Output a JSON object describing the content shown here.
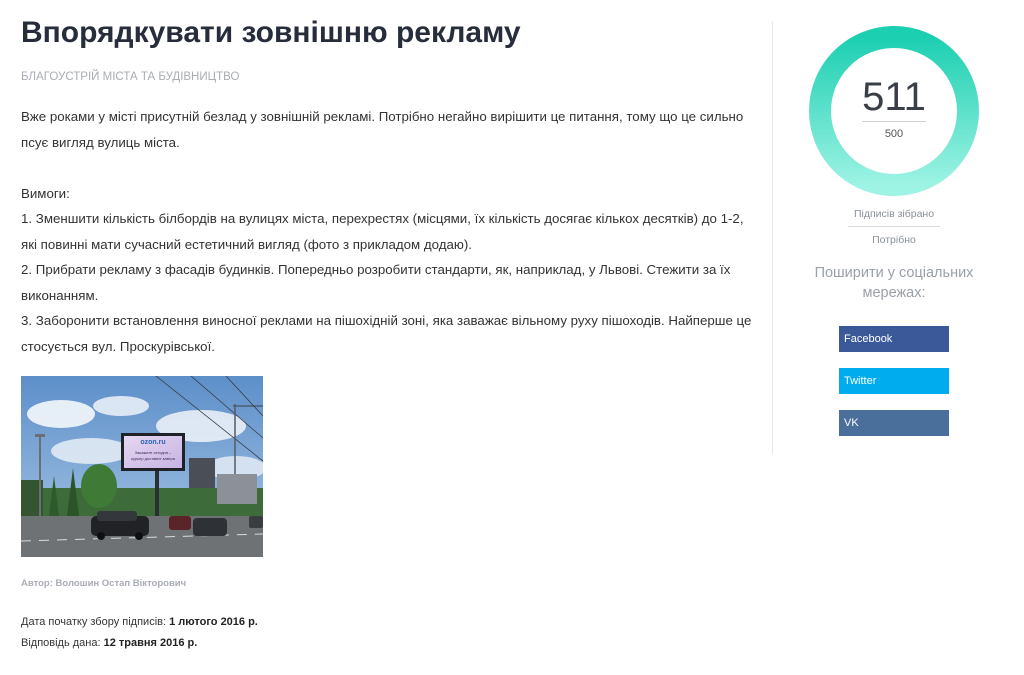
{
  "petition": {
    "title": "Впорядкувати зовнішню рекламу",
    "category": "БЛАГОУСТРІЙ МІСТА ТА БУДІВНИЦТВО",
    "paragraphs": [
      "Вже роками у місті присутній безлад у зовнішній рекламі. Потрібно негайно вирішити це питання, тому що це сильно псує вигляд вулиць міста."
    ],
    "requirements_heading": "Вимоги:",
    "requirements": [
      "1. Зменшити кількість білбордів на вулицях міста, перехрестях (місцями, їх кількість досягає кількох десятків) до 1-2, які повинні мати сучасний естетичний вигляд (фото з прикладом додаю).",
      "2. Прибрати рекламу з фасадів будинків. Попередньо розробити стандарти, як, наприклад, у Львові. Стежити за їх виконанням.",
      "3. Заборонити встановлення виносної реклами на пішохідній зоні, яка заважає вільному руху пішоходів. Найперше це стосується вул. Проскурівської."
    ],
    "photo": {
      "billboard_brand": "ozon.ru",
      "billboard_line1": "Закажите сегодня –",
      "billboard_line2": "курьер доставит завтра"
    },
    "author": "Автор: Волошин Остап Вікторович",
    "start_label": "Дата початку збору підписів:",
    "start_date": "1 лютого 2016 р.",
    "answer_label": "Відповідь дана:",
    "answer_date": "12 травня 2016 р."
  },
  "signatures": {
    "collected": "511",
    "required": "500",
    "progress_fraction": 1.0,
    "collected_label": "Підписів зібрано",
    "required_label": "Потрібно",
    "ring_color_start": "#9df3e4",
    "ring_color_end": "#1ccfb1"
  },
  "share": {
    "heading": "Поширити у соціальних мережах:",
    "buttons": [
      {
        "label": "Facebook",
        "color": "#3b5998"
      },
      {
        "label": "Twitter",
        "color": "#00aced"
      },
      {
        "label": "VK",
        "color": "#4a6f9b"
      }
    ]
  }
}
